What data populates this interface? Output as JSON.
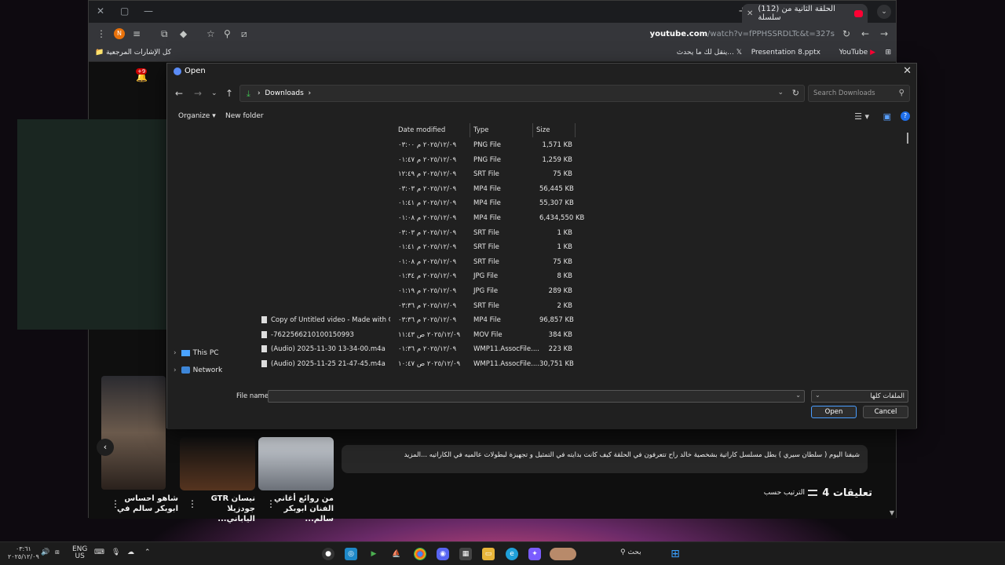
{
  "browser": {
    "tab_title": "(112) الحلقة الثانية من سلسلة",
    "url_domain": "youtube.com",
    "url_path": "/watch?v=fPPHSSRDLTc&t=327s",
    "profile_initial": "N",
    "bookmarks": {
      "all": "كل الإشارات المرجعية",
      "b1": "ينقل لك ما يحدث...",
      "b2": "Presentation 8.pptx",
      "b3": "YouTube"
    }
  },
  "youtube": {
    "notif_badge": "+9",
    "comments_count": "4 تعليقات",
    "sort_by": "الترتيب حسب",
    "description": "شيفنا اليوم ( سلطان سيري ) بطل مسلسل كاراتية بشخصية خالد راح تتعرفون في الحلقة كيف كانت بدايته في التمثيل و تجهيزة لبطولات عالميه في الكاراتيه ...المزيد",
    "videos": [
      {
        "title": "شاهو احساس ابوبكر سالم في"
      },
      {
        "title": "نيسان GTR جودزيلا الياباني..."
      },
      {
        "title": "من روائع أغاني الفنان ابوبكر سالم..."
      }
    ]
  },
  "dialog": {
    "title": "Open",
    "breadcrumb": "Downloads",
    "search_placeholder": "Search Downloads",
    "organize": "Organize",
    "new_folder": "New folder",
    "columns": {
      "date": "Date modified",
      "type": "Type",
      "size": "Size"
    },
    "nav": [
      {
        "label": "This PC"
      },
      {
        "label": "Network"
      }
    ],
    "files": [
      {
        "name": "",
        "date": "٢٠٢٥/١٢/٠٩ م ٠٣:٠٠",
        "type": "PNG File",
        "size": "1,571 KB"
      },
      {
        "name": "",
        "date": "٢٠٢٥/١٢/٠٩ م ٠١:٤٧",
        "type": "PNG File",
        "size": "1,259 KB"
      },
      {
        "name": "",
        "date": "٢٠٢٥/١٢/٠٩ م ١٢:٤٩",
        "type": "SRT File",
        "size": "75 KB"
      },
      {
        "name": "",
        "date": "٢٠٢٥/١٢/٠٩ م ٠٣:٠٣",
        "type": "MP4 File",
        "size": "56,445 KB"
      },
      {
        "name": "",
        "date": "٢٠٢٥/١٢/٠٩ م ٠١:٤١",
        "type": "MP4 File",
        "size": "55,307 KB"
      },
      {
        "name": "",
        "date": "٢٠٢٥/١٢/٠٩ م ٠١:٠٨",
        "type": "MP4 File",
        "size": "6,434,550 KB"
      },
      {
        "name": "",
        "date": "٢٠٢٥/١٢/٠٩ م ٠٣:٠٣",
        "type": "SRT File",
        "size": "1 KB"
      },
      {
        "name": "",
        "date": "٢٠٢٥/١٢/٠٩ م ٠١:٤١",
        "type": "SRT File",
        "size": "1 KB"
      },
      {
        "name": "",
        "date": "٢٠٢٥/١٢/٠٩ م ٠١:٠٨",
        "type": "SRT File",
        "size": "75 KB"
      },
      {
        "name": "",
        "date": "٢٠٢٥/١٢/٠٩ م ٠١:٣٤",
        "type": "JPG File",
        "size": "8 KB"
      },
      {
        "name": "",
        "date": "٢٠٢٥/١٢/٠٩ م ٠١:١٩",
        "type": "JPG File",
        "size": "289 KB"
      },
      {
        "name": "",
        "date": "٢٠٢٥/١٢/٠٩ م ٠٣:٣٦",
        "type": "SRT File",
        "size": "2 KB"
      },
      {
        "name": "Copy of Untitled video - Made with Clipc...",
        "date": "٢٠٢٥/١٢/٠٩ م ٠٣:٣٦",
        "type": "MP4 File",
        "size": "96,857 KB"
      },
      {
        "name": "-762256621010015099З",
        "date": "٢٠٢٥/١٢/٠٩ ص ١١:٤٣",
        "type": "MOV File",
        "size": "384 KB"
      },
      {
        "name": "(Audio) 2025-11-30 13-34-00.m4a",
        "date": "٢٠٢٥/١٢/٠٩ م ٠١:٣٦",
        "type": "WMP11.AssocFile....",
        "size": "223 KB"
      },
      {
        "name": "(Audio) 2025-11-25 21-47-45.m4a",
        "date": "٢٠٢٥/١٢/٠٩ ص ١٠:٤٧",
        "type": "WMP11.AssocFile....",
        "size": "30,751 KB"
      }
    ],
    "file_name_label": "File name:",
    "file_name_value": "",
    "file_type": "الملفات كلها",
    "open_label": "Open",
    "cancel_label": "Cancel"
  },
  "taskbar": {
    "time": "٠٣:٦١",
    "date": "٢٠٢٥/١٢/٠٩",
    "lang1": "ENG",
    "lang2": "US",
    "search_label": "بحث"
  }
}
